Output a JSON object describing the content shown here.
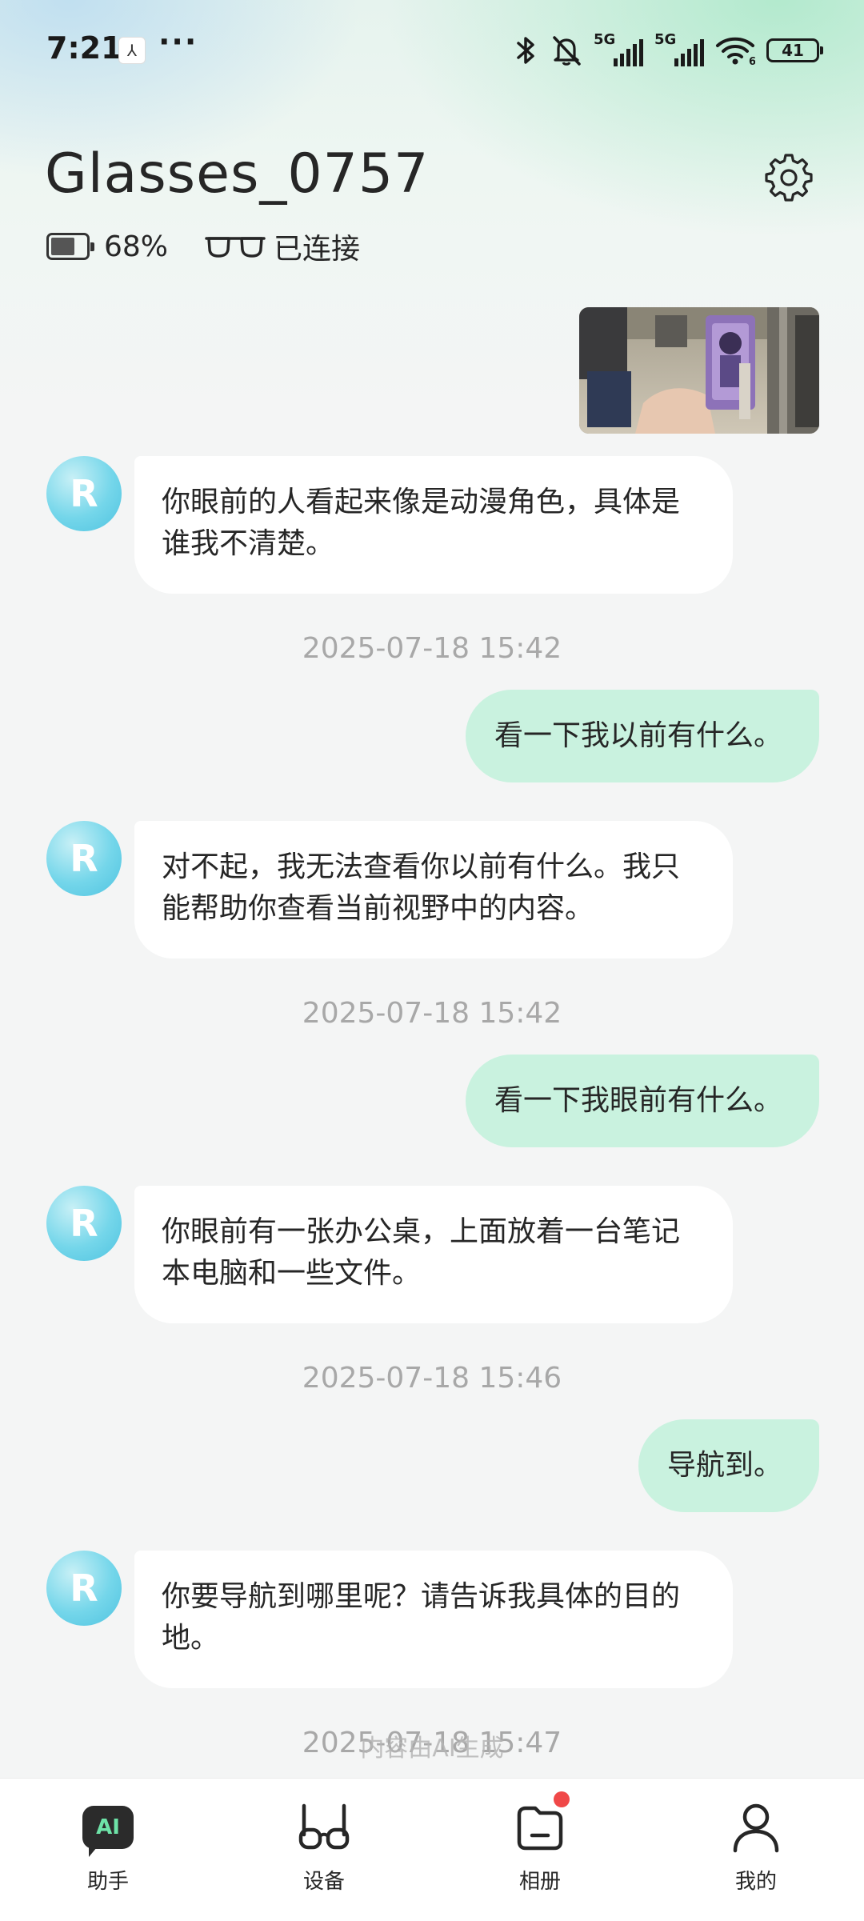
{
  "status_bar": {
    "time": "7:21",
    "more": "···",
    "sim1_label": "5G",
    "sim2_label": "5G",
    "wifi_label": "6",
    "battery_level": "41",
    "icons": [
      "bluetooth-icon",
      "mute-bell-icon",
      "signal-icon",
      "wifi-icon",
      "battery-icon"
    ]
  },
  "header": {
    "device_name": "Glasses_0757",
    "battery_percent": "68%",
    "battery_fill_fraction": 0.68,
    "connection_status": "已连接",
    "settings_icon": "gear-icon"
  },
  "messages": [
    {
      "type": "image",
      "from": "user"
    },
    {
      "type": "ai",
      "text": "你眼前的人看起来像是动漫角色，具体是谁我不清楚。"
    },
    {
      "type": "timestamp",
      "text": "2025-07-18 15:42"
    },
    {
      "type": "user",
      "text": "看一下我以前有什么。"
    },
    {
      "type": "ai",
      "text": "对不起，我无法查看你以前有什么。我只能帮助你查看当前视野中的内容。"
    },
    {
      "type": "timestamp",
      "text": "2025-07-18 15:42"
    },
    {
      "type": "user",
      "text": "看一下我眼前有什么。"
    },
    {
      "type": "ai",
      "text": "你眼前有一张办公桌，上面放着一台笔记本电脑和一些文件。"
    },
    {
      "type": "timestamp",
      "text": "2025-07-18 15:46"
    },
    {
      "type": "user",
      "text": "导航到。"
    },
    {
      "type": "ai",
      "text": "你要导航到哪里呢？请告诉我具体的目的地。"
    },
    {
      "type": "timestamp",
      "text": "2025-07-18 15:47"
    }
  ],
  "avatar_letter": "R",
  "ai_note": "内容由AI生成",
  "bottom_nav": [
    {
      "label": "助手",
      "icon": "ai-assistant-icon",
      "icon_text": "AI"
    },
    {
      "label": "设备",
      "icon": "glasses-device-icon"
    },
    {
      "label": "相册",
      "icon": "album-folder-icon"
    },
    {
      "label": "我的",
      "icon": "profile-person-icon"
    }
  ],
  "colors": {
    "user_bubble": "#c9f2df",
    "ai_bubble": "#ffffff",
    "timestamp": "#a8a8a8",
    "badge": "#f04848",
    "ai_icon_text": "#6ee3a8"
  }
}
